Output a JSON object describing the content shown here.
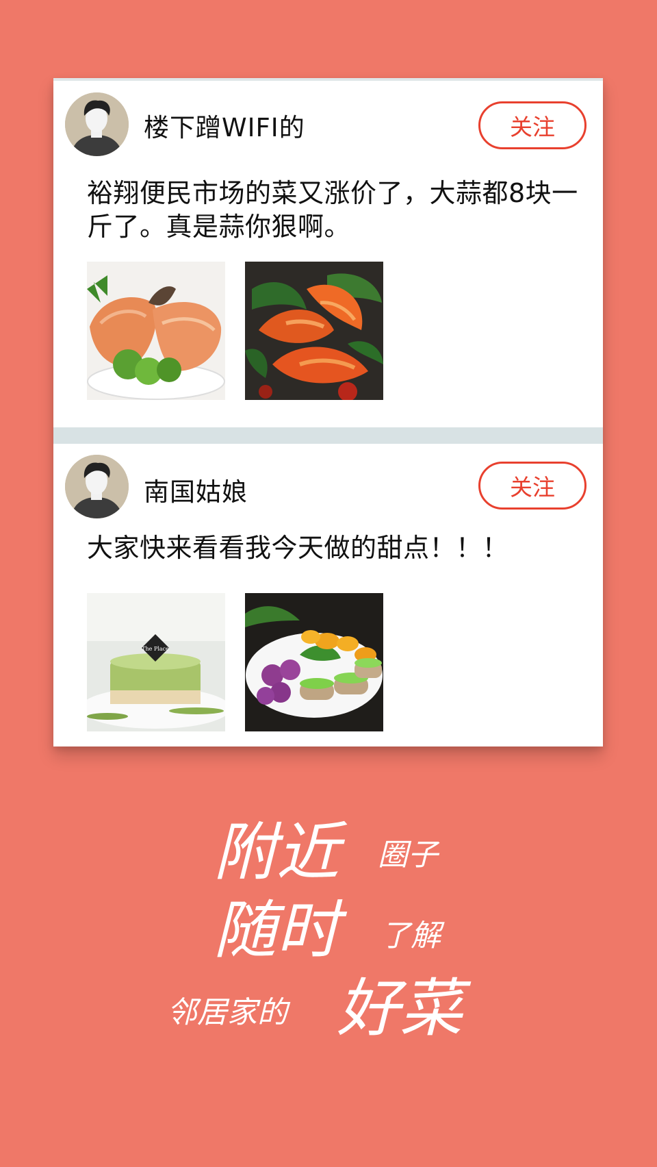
{
  "colors": {
    "background": "#ef7868",
    "card": "#ffffff",
    "divider": "#d8e2e4",
    "accent": "#e8402e",
    "text": "#111111",
    "slogan": "#ffffff"
  },
  "posts": [
    {
      "username": "楼下蹭WIFI的",
      "follow_label": "关注",
      "text": "裕翔便民市场的菜又涨价了，大蒜都8块一斤了。真是蒜你狠啊。",
      "avatar_icon": "user-avatar",
      "photos": [
        {
          "name": "salmon-steak-photo"
        },
        {
          "name": "spicy-shrimp-photo"
        }
      ]
    },
    {
      "username": "南国姑娘",
      "follow_label": "关注",
      "text": "大家快来看看我今天做的甜点！！！",
      "avatar_icon": "user-avatar",
      "photos": [
        {
          "name": "matcha-cake-photo",
          "caption": "The Place"
        },
        {
          "name": "dessert-platter-photo"
        }
      ]
    }
  ],
  "slogan": {
    "line1_big": "附近",
    "line1_small": "圈子",
    "line2_big": "随时",
    "line2_small": "了解",
    "line3_small": "邻居家的",
    "line3_big": "好菜"
  }
}
